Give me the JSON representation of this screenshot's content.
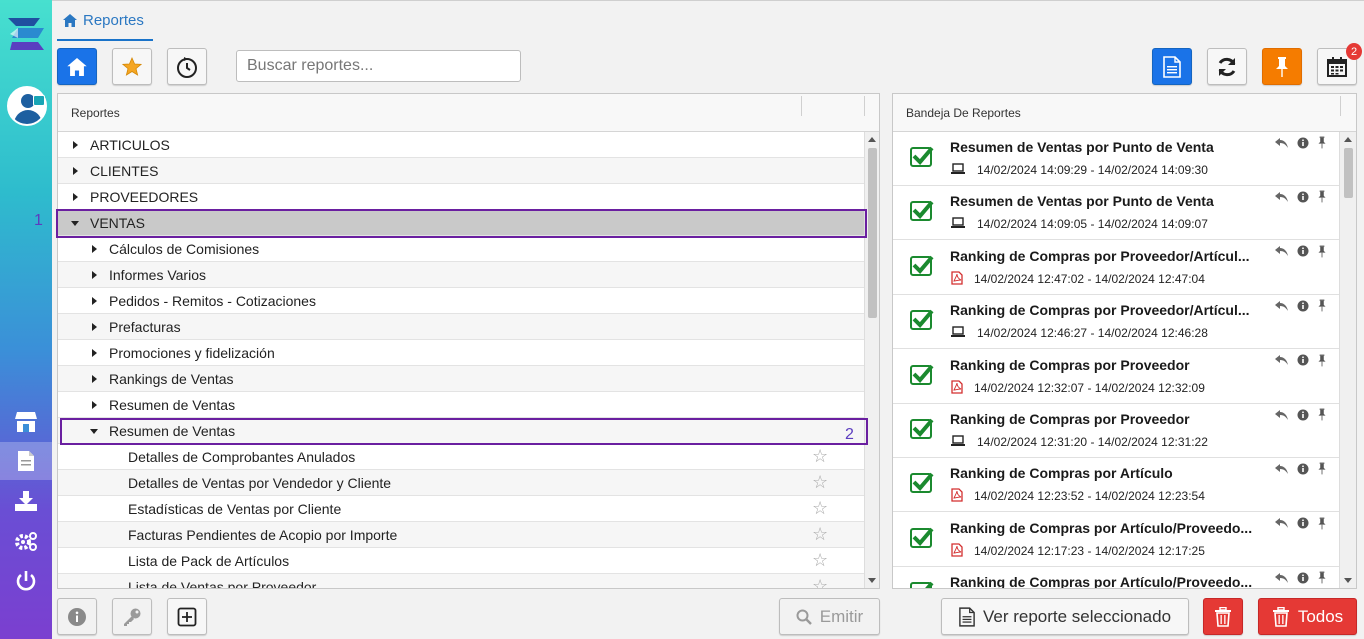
{
  "breadcrumb": {
    "label": "Reportes"
  },
  "search": {
    "placeholder": "Buscar reportes..."
  },
  "notifications": {
    "calendar_count": "2"
  },
  "left_panel": {
    "header": "Reportes",
    "rows": [
      "ARTICULOS",
      "CLIENTES",
      "PROVEEDORES",
      "VENTAS",
      "Cálculos de Comisiones",
      "Informes Varios",
      "Pedidos - Remitos - Cotizaciones",
      "Prefacturas",
      "Promociones y fidelización",
      "Rankings de Ventas",
      "Resumen de Ventas",
      "Resumen de Ventas",
      "Detalles de Comprobantes Anulados",
      "Detalles de Ventas por Vendedor y Cliente",
      "Estadísticas de Ventas por Cliente",
      "Facturas Pendientes de Acopio por Importe",
      "Lista de Pack de Artículos",
      "Lista de Ventas por Proveedor"
    ],
    "highlight_1": "1",
    "highlight_2": "2"
  },
  "right_panel": {
    "header": "Bandeja De Reportes",
    "items": [
      {
        "title": "Resumen de Ventas por Punto de Venta",
        "date": "14/02/2024 14:09:29 - 14/02/2024 14:09:30",
        "device": "laptop-icon"
      },
      {
        "title": "Resumen de Ventas por Punto de Venta",
        "date": "14/02/2024 14:09:05 - 14/02/2024 14:09:07",
        "device": "laptop-icon"
      },
      {
        "title": "Ranking de Compras por Proveedor/Artícul...",
        "date": "14/02/2024 12:47:02 - 14/02/2024 12:47:04",
        "device": "pdf-icon"
      },
      {
        "title": "Ranking de Compras por Proveedor/Artícul...",
        "date": "14/02/2024 12:46:27 - 14/02/2024 12:46:28",
        "device": "laptop-icon"
      },
      {
        "title": "Ranking de Compras por Proveedor",
        "date": "14/02/2024 12:32:07 - 14/02/2024 12:32:09",
        "device": "pdf-icon"
      },
      {
        "title": "Ranking de Compras por Proveedor",
        "date": "14/02/2024 12:31:20 - 14/02/2024 12:31:22",
        "device": "laptop-icon"
      },
      {
        "title": "Ranking de Compras por Artículo",
        "date": "14/02/2024 12:23:52 - 14/02/2024 12:23:54",
        "device": "pdf-icon"
      },
      {
        "title": "Ranking de Compras por Artículo/Proveedo...",
        "date": "14/02/2024 12:17:23 - 14/02/2024 12:17:25",
        "device": "pdf-icon"
      },
      {
        "title": "Ranking de Compras por Artículo/Proveedo...",
        "date": "",
        "device": "pdf-icon"
      }
    ]
  },
  "bottom": {
    "emit_label": "Emitir",
    "view_label": "Ver reporte seleccionado",
    "all_label": "Todos"
  },
  "colors": {
    "accent": "#1a73e8",
    "orange": "#f57c00",
    "danger": "#e53935",
    "success": "#1b8a2f",
    "highlight": "#6a1fa0"
  }
}
